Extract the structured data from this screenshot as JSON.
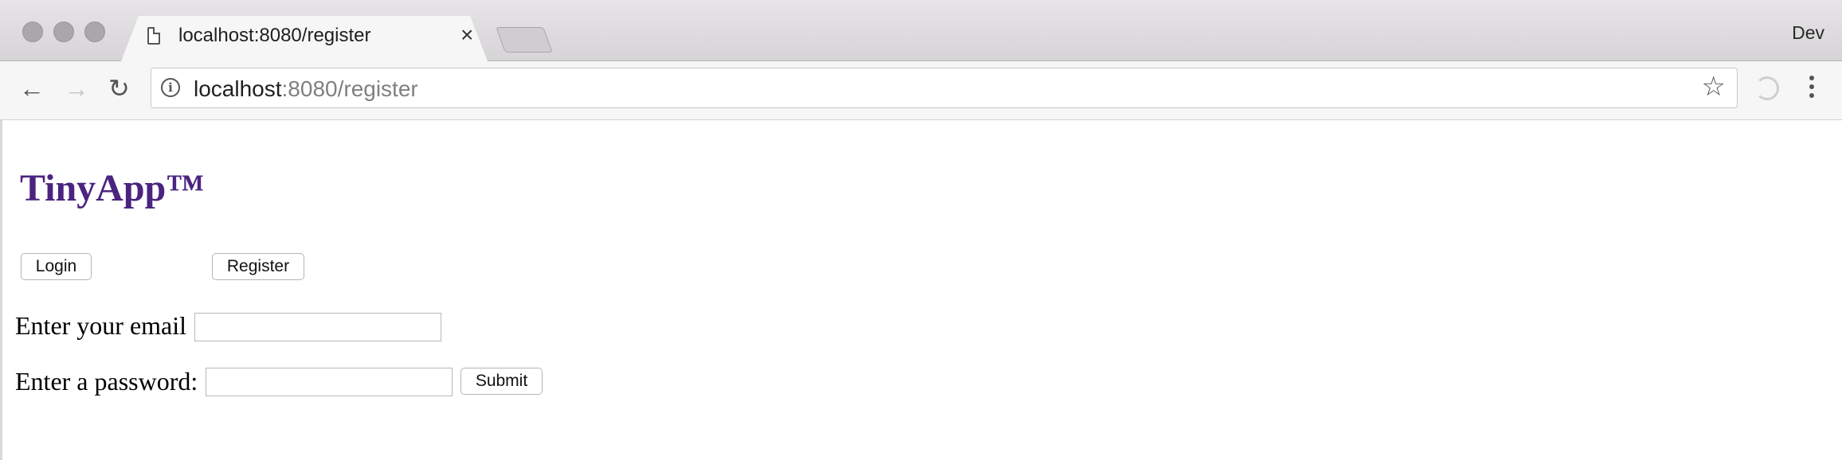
{
  "browser": {
    "tab_title": "localhost:8080/register",
    "tab_close": "×",
    "profile_name": "Dev",
    "url_host": "localhost",
    "url_rest": ":8080/register",
    "back_glyph": "←",
    "forward_glyph": "→",
    "reload_glyph": "↻",
    "star_glyph": "☆",
    "info_glyph": "i"
  },
  "page": {
    "app_title": "TinyApp™",
    "login_label": "Login",
    "register_label": "Register",
    "email_label": "Enter your email",
    "email_value": "",
    "password_label": "Enter a password:",
    "password_value": "",
    "submit_label": "Submit"
  },
  "colors": {
    "title_purple": "#4b2380",
    "chrome_gray": "#d6d4d6"
  }
}
